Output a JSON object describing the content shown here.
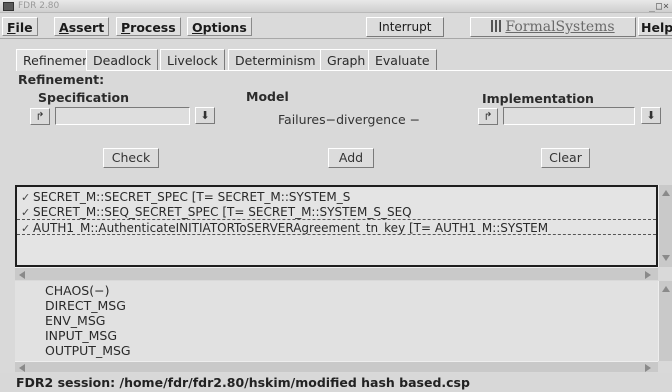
{
  "window": {
    "title": "FDR 2.80",
    "controls": "_□×"
  },
  "menu": {
    "items": [
      {
        "pre": "",
        "u": "F",
        "post": "ile"
      },
      {
        "pre": "",
        "u": "A",
        "post": "ssert"
      },
      {
        "pre": "",
        "u": "P",
        "post": "rocess"
      },
      {
        "pre": "",
        "u": "O",
        "post": "ptions"
      }
    ],
    "interrupt": "Interrupt",
    "logo": "FormalSystems",
    "help": "Help"
  },
  "tabs": [
    "Refinement",
    "Deadlock",
    "Livelock",
    "Determinism",
    "Graph",
    "Evaluate"
  ],
  "refinement": {
    "heading": "Refinement:",
    "specification_label": "Specification",
    "model_label": "Model",
    "model_value": "Failures−divergence",
    "model_dash": "−",
    "implementation_label": "Implementation",
    "specification_value": "",
    "implementation_value": ""
  },
  "buttons": {
    "check": "Check",
    "add": "Add",
    "clear": "Clear"
  },
  "icons": {
    "load": "↱",
    "dropdown": "⬇",
    "check_mark": "✓"
  },
  "results": [
    {
      "text": "SECRET_M::SECRET_SPEC [T= SECRET_M::SYSTEM_S",
      "passed": true,
      "selected": false
    },
    {
      "text": "SECRET_M::SEQ_SECRET_SPEC [T= SECRET_M::SYSTEM_S_SEQ",
      "passed": true,
      "selected": false
    },
    {
      "text": "AUTH1_M::AuthenticateINITIATORToSERVERAgreement_tn_key [T= AUTH1_M::SYSTEM",
      "passed": true,
      "selected": true
    }
  ],
  "processes": [
    "CHAOS(−)",
    "DIRECT_MSG",
    "ENV_MSG",
    "INPUT_MSG",
    "OUTPUT_MSG"
  ],
  "status": "FDR2 session: /home/fdr/fdr2.80/hskim/modified hash based.csp"
}
